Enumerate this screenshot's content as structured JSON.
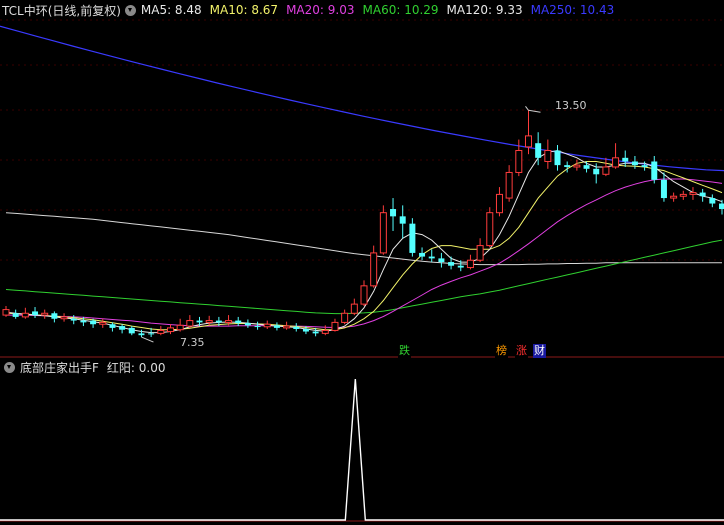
{
  "header": {
    "title": "TCL中环(日线,前复权)",
    "ma": [
      {
        "label": "MA5: 8.48",
        "color": "#e8e8e8"
      },
      {
        "label": "MA10: 8.67",
        "color": "#f2f26a"
      },
      {
        "label": "MA20: 9.03",
        "color": "#e040e0"
      },
      {
        "label": "MA60: 10.29",
        "color": "#30d030"
      },
      {
        "label": "MA120: 9.33",
        "color": "#e8e8e8"
      },
      {
        "label": "MA250: 10.43",
        "color": "#3a3aff"
      }
    ]
  },
  "annotations": {
    "high": "13.50",
    "low": "7.35"
  },
  "badges": [
    {
      "label": "跌",
      "color": "#30d030",
      "bg": "#000"
    },
    {
      "label": "榜",
      "color": "#ff9a00",
      "bg": "#000"
    },
    {
      "label": "涨",
      "color": "#ff3030",
      "bg": "#000"
    },
    {
      "label": "财",
      "color": "#ffffff",
      "bg": "#1a1aa0"
    }
  ],
  "indicator": {
    "title": "底部庄家出手F",
    "value_label": "红阳: 0.00"
  },
  "colors": {
    "up": "#ff3c3c",
    "down": "#54ffff",
    "bg": "#000000",
    "divider": "#8b1a1a"
  },
  "chart_data": {
    "type": "candlestick",
    "candles": [
      [
        7.9,
        8.05,
        7.85,
        8.15
      ],
      [
        7.95,
        7.85,
        7.8,
        8.05
      ],
      [
        7.85,
        7.95,
        7.8,
        8.1
      ],
      [
        8.0,
        7.9,
        7.82,
        8.12
      ],
      [
        7.9,
        7.95,
        7.8,
        8.05
      ],
      [
        7.95,
        7.8,
        7.7,
        8.0
      ],
      [
        7.8,
        7.85,
        7.72,
        7.95
      ],
      [
        7.8,
        7.75,
        7.65,
        7.9
      ],
      [
        7.75,
        7.7,
        7.6,
        7.85
      ],
      [
        7.75,
        7.65,
        7.55,
        7.8
      ],
      [
        7.65,
        7.7,
        7.55,
        7.8
      ],
      [
        7.65,
        7.55,
        7.45,
        7.7
      ],
      [
        7.6,
        7.5,
        7.4,
        7.65
      ],
      [
        7.55,
        7.4,
        7.35,
        7.6
      ],
      [
        7.4,
        7.35,
        7.3,
        7.5
      ],
      [
        7.4,
        7.38,
        7.3,
        7.55
      ],
      [
        7.4,
        7.48,
        7.35,
        7.6
      ],
      [
        7.45,
        7.55,
        7.38,
        7.65
      ],
      [
        7.5,
        7.62,
        7.45,
        7.8
      ],
      [
        7.6,
        7.75,
        7.55,
        7.9
      ],
      [
        7.75,
        7.7,
        7.6,
        7.85
      ],
      [
        7.7,
        7.75,
        7.62,
        7.88
      ],
      [
        7.75,
        7.7,
        7.6,
        7.85
      ],
      [
        7.7,
        7.75,
        7.62,
        7.9
      ],
      [
        7.75,
        7.68,
        7.6,
        7.85
      ],
      [
        7.68,
        7.62,
        7.55,
        7.78
      ],
      [
        7.6,
        7.58,
        7.5,
        7.72
      ],
      [
        7.58,
        7.65,
        7.52,
        7.75
      ],
      [
        7.62,
        7.55,
        7.48,
        7.7
      ],
      [
        7.55,
        7.6,
        7.5,
        7.72
      ],
      [
        7.58,
        7.52,
        7.45,
        7.68
      ],
      [
        7.52,
        7.45,
        7.38,
        7.6
      ],
      [
        7.45,
        7.4,
        7.32,
        7.55
      ],
      [
        7.4,
        7.48,
        7.35,
        7.62
      ],
      [
        7.48,
        7.7,
        7.45,
        7.8
      ],
      [
        7.7,
        7.95,
        7.65,
        8.05
      ],
      [
        7.95,
        8.2,
        7.9,
        8.35
      ],
      [
        8.2,
        8.7,
        8.15,
        8.85
      ],
      [
        8.7,
        9.6,
        8.65,
        9.8
      ],
      [
        9.6,
        10.7,
        9.55,
        10.9
      ],
      [
        10.8,
        10.6,
        10.2,
        11.1
      ],
      [
        10.6,
        10.4,
        10.0,
        10.9
      ],
      [
        10.4,
        9.6,
        9.5,
        10.55
      ],
      [
        9.6,
        9.5,
        9.4,
        9.75
      ],
      [
        9.5,
        9.45,
        9.35,
        9.7
      ],
      [
        9.45,
        9.35,
        9.2,
        9.6
      ],
      [
        9.35,
        9.25,
        9.15,
        9.5
      ],
      [
        9.25,
        9.2,
        9.1,
        9.4
      ],
      [
        9.2,
        9.4,
        9.15,
        9.55
      ],
      [
        9.4,
        9.8,
        9.35,
        10.0
      ],
      [
        9.8,
        10.7,
        9.75,
        10.85
      ],
      [
        10.7,
        11.2,
        10.6,
        11.4
      ],
      [
        11.1,
        11.8,
        11.0,
        12.0
      ],
      [
        11.8,
        12.4,
        11.7,
        12.7
      ],
      [
        12.5,
        12.8,
        12.3,
        13.5
      ],
      [
        12.6,
        12.2,
        12.0,
        12.9
      ],
      [
        12.1,
        12.4,
        11.9,
        12.7
      ],
      [
        12.4,
        12.0,
        11.85,
        12.55
      ],
      [
        12.0,
        11.95,
        11.8,
        12.1
      ],
      [
        11.95,
        12.0,
        11.85,
        12.15
      ],
      [
        12.0,
        11.9,
        11.8,
        12.1
      ],
      [
        11.9,
        11.75,
        11.5,
        12.05
      ],
      [
        11.75,
        11.95,
        11.7,
        12.2
      ],
      [
        11.95,
        12.2,
        11.9,
        12.6
      ],
      [
        12.2,
        12.1,
        11.95,
        12.4
      ],
      [
        12.1,
        12.0,
        11.9,
        12.25
      ],
      [
        12.0,
        11.95,
        11.85,
        12.1
      ],
      [
        12.1,
        11.6,
        11.5,
        12.25
      ],
      [
        11.6,
        11.1,
        11.0,
        11.8
      ],
      [
        11.1,
        11.15,
        11.0,
        11.25
      ],
      [
        11.15,
        11.2,
        11.05,
        11.3
      ],
      [
        11.2,
        11.25,
        11.05,
        11.4
      ],
      [
        11.25,
        11.15,
        11.0,
        11.35
      ],
      [
        11.1,
        10.95,
        10.85,
        11.2
      ],
      [
        10.95,
        10.8,
        10.65,
        11.05
      ]
    ],
    "ma5": [
      7.98,
      7.95,
      7.92,
      7.9,
      7.88,
      7.85,
      7.82,
      7.8,
      7.76,
      7.72,
      7.68,
      7.62,
      7.56,
      7.5,
      7.45,
      7.42,
      7.42,
      7.45,
      7.5,
      7.58,
      7.64,
      7.68,
      7.7,
      7.71,
      7.7,
      7.68,
      7.65,
      7.62,
      7.6,
      7.58,
      7.56,
      7.52,
      7.48,
      7.46,
      7.5,
      7.6,
      7.8,
      8.1,
      8.55,
      9.15,
      9.7,
      10.0,
      10.15,
      10.1,
      9.95,
      9.7,
      9.45,
      9.35,
      9.35,
      9.45,
      9.7,
      10.1,
      10.6,
      11.2,
      11.8,
      12.2,
      12.35,
      12.4,
      12.3,
      12.2,
      12.05,
      11.95,
      11.95,
      12.0,
      12.05,
      12.05,
      12.05,
      11.95,
      11.75,
      11.55,
      11.4,
      11.25,
      11.15,
      11.1,
      11.0
    ],
    "ma10": [
      7.95,
      7.94,
      7.93,
      7.91,
      7.89,
      7.87,
      7.85,
      7.83,
      7.8,
      7.77,
      7.73,
      7.69,
      7.65,
      7.6,
      7.56,
      7.52,
      7.5,
      7.5,
      7.51,
      7.54,
      7.58,
      7.62,
      7.64,
      7.66,
      7.67,
      7.67,
      7.66,
      7.65,
      7.63,
      7.61,
      7.59,
      7.56,
      7.53,
      7.5,
      7.5,
      7.55,
      7.65,
      7.8,
      8.0,
      8.3,
      8.65,
      9.0,
      9.3,
      9.55,
      9.72,
      9.8,
      9.8,
      9.75,
      9.7,
      9.7,
      9.7,
      9.8,
      10.0,
      10.3,
      10.7,
      11.1,
      11.4,
      11.7,
      11.9,
      12.05,
      12.1,
      12.1,
      12.05,
      12.0,
      11.98,
      11.97,
      11.95,
      11.9,
      11.85,
      11.75,
      11.65,
      11.55,
      11.45,
      11.35,
      11.25
    ],
    "ma20": [
      7.9,
      7.9,
      7.9,
      7.89,
      7.88,
      7.87,
      7.86,
      7.85,
      7.84,
      7.82,
      7.8,
      7.78,
      7.76,
      7.74,
      7.71,
      7.68,
      7.66,
      7.64,
      7.62,
      7.61,
      7.6,
      7.6,
      7.6,
      7.6,
      7.61,
      7.61,
      7.61,
      7.61,
      7.61,
      7.6,
      7.6,
      7.59,
      7.58,
      7.57,
      7.56,
      7.57,
      7.6,
      7.66,
      7.75,
      7.86,
      8.0,
      8.15,
      8.3,
      8.45,
      8.6,
      8.72,
      8.82,
      8.92,
      9.0,
      9.1,
      9.2,
      9.32,
      9.48,
      9.66,
      9.85,
      10.05,
      10.25,
      10.45,
      10.62,
      10.78,
      10.92,
      11.05,
      11.18,
      11.3,
      11.4,
      11.48,
      11.55,
      11.6,
      11.62,
      11.62,
      11.62,
      11.6,
      11.57,
      11.54,
      11.5
    ],
    "ma60": [
      8.6,
      8.58,
      8.56,
      8.54,
      8.52,
      8.5,
      8.48,
      8.46,
      8.44,
      8.42,
      8.4,
      8.38,
      8.36,
      8.34,
      8.32,
      8.3,
      8.28,
      8.26,
      8.24,
      8.22,
      8.2,
      8.18,
      8.16,
      8.14,
      8.12,
      8.1,
      8.08,
      8.06,
      8.04,
      8.02,
      8.0,
      7.98,
      7.96,
      7.95,
      7.94,
      7.94,
      7.95,
      7.96,
      7.98,
      8.01,
      8.05,
      8.1,
      8.15,
      8.2,
      8.25,
      8.3,
      8.35,
      8.4,
      8.44,
      8.48,
      8.53,
      8.58,
      8.64,
      8.7,
      8.76,
      8.82,
      8.88,
      8.94,
      9.0,
      9.06,
      9.12,
      9.18,
      9.24,
      9.3,
      9.36,
      9.42,
      9.48,
      9.54,
      9.6,
      9.66,
      9.72,
      9.78,
      9.84,
      9.9,
      9.95
    ],
    "ma120": [
      10.7,
      10.68,
      10.66,
      10.64,
      10.62,
      10.6,
      10.58,
      10.56,
      10.54,
      10.52,
      10.49,
      10.46,
      10.43,
      10.4,
      10.37,
      10.34,
      10.31,
      10.28,
      10.25,
      10.22,
      10.19,
      10.16,
      10.13,
      10.1,
      10.06,
      10.02,
      9.98,
      9.94,
      9.9,
      9.86,
      9.82,
      9.78,
      9.74,
      9.7,
      9.66,
      9.62,
      9.58,
      9.55,
      9.52,
      9.49,
      9.46,
      9.43,
      9.4,
      9.37,
      9.35,
      9.33,
      9.31,
      9.3,
      9.29,
      9.28,
      9.28,
      9.28,
      9.28,
      9.28,
      9.29,
      9.29,
      9.3,
      9.3,
      9.31,
      9.31,
      9.32,
      9.32,
      9.33,
      9.33,
      9.33,
      9.33,
      9.33,
      9.33,
      9.33,
      9.33,
      9.33,
      9.33,
      9.33,
      9.33,
      9.33
    ],
    "ma250_start": 15.8,
    "ma250_end": 11.85,
    "indicator_values": {
      "peak_index": 36,
      "peak": 1,
      "baseline": 0
    }
  }
}
